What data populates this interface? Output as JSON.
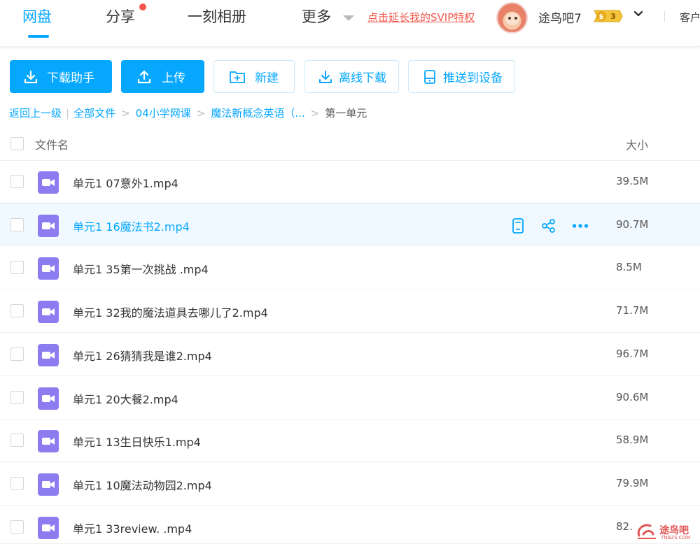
{
  "nav": {
    "items": [
      {
        "label": "网盘",
        "active": true
      },
      {
        "label": "分享",
        "has_dot": true
      },
      {
        "label": "一刻相册"
      },
      {
        "label": "更多"
      }
    ],
    "promo_link": "点击延长我的SVIP特权",
    "username": "途鸟吧7",
    "vip_level": "3",
    "client_label": "客户"
  },
  "toolbar": {
    "download_helper": "下载助手",
    "upload": "上传",
    "new": "新建",
    "offline_download": "离线下载",
    "push_to_device": "推送到设备"
  },
  "breadcrumb": {
    "back": "返回上一级",
    "all_files": "全部文件",
    "level1": "04小学网课",
    "level2": "魔法新概念英语（...",
    "current": "第一单元"
  },
  "table": {
    "col_name": "文件名",
    "col_size": "大小",
    "rows": [
      {
        "name": "单元1 07意外1.mp4",
        "size": "39.5M"
      },
      {
        "name": "单元1 16魔法书2.mp4",
        "size": "90.7M",
        "hovered": true
      },
      {
        "name": "单元1 35第一次挑战 .mp4",
        "size": "8.5M"
      },
      {
        "name": "单元1 32我的魔法道具去哪儿了2.mp4",
        "size": "71.7M"
      },
      {
        "name": "单元1 26猜猜我是谁2.mp4",
        "size": "96.7M"
      },
      {
        "name": "单元1 20大餐2.mp4",
        "size": "90.6M"
      },
      {
        "name": "单元1 13生日快乐1.mp4",
        "size": "58.9M"
      },
      {
        "name": "单元1 10魔法动物园2.mp4",
        "size": "79.9M"
      },
      {
        "name": "单元1 33review. .mp4",
        "size": "82."
      }
    ]
  },
  "watermark": {
    "text": "途鸟吧",
    "sub": "TNBZS.COM"
  },
  "colors": {
    "accent": "#06a7ff",
    "promo": "#f2574a",
    "video_icon": "#8c7cf0"
  }
}
